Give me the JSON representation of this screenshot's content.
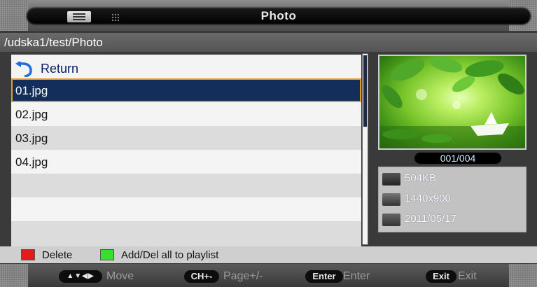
{
  "header": {
    "title": "Photo"
  },
  "path": "/udska1/test/Photo",
  "list": {
    "return_label": "Return",
    "items": [
      "01.jpg",
      "02.jpg",
      "03.jpg",
      "04.jpg"
    ],
    "selected_index": 0
  },
  "preview": {
    "counter": "001/004",
    "size": "504KB",
    "resolution": "1440x900",
    "date": "2011/05/17"
  },
  "legend": {
    "red_label": "Delete",
    "green_label": "Add/Del all to playlist",
    "red_color": "#e41b1b",
    "green_color": "#39e02b"
  },
  "footer": {
    "move_key": "▲▼◀▶",
    "move_label": "Move",
    "page_key": "CH+-",
    "page_label": "Page+/-",
    "enter_key": "Enter",
    "enter_label": "Enter",
    "exit_key": "Exit",
    "exit_label": "Exit"
  }
}
